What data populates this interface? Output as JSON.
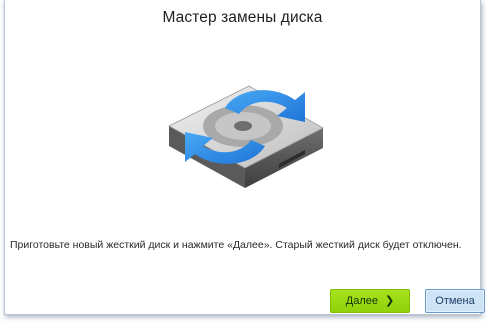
{
  "dialog": {
    "title": "Мастер замены диска",
    "description": "Приготовьте новый жесткий диск и нажмите «Далее».  Старый жесткий диск будет отключен.",
    "illustration_icon": "hard-drive-replace-icon"
  },
  "buttons": {
    "next_label": "Далее",
    "next_icon": "chevron-right-icon",
    "cancel_label": "Отмена"
  },
  "colors": {
    "next_button": "#98d814",
    "cancel_button": "#cfe3f6",
    "arrow_blue": "#2f8fe8"
  }
}
